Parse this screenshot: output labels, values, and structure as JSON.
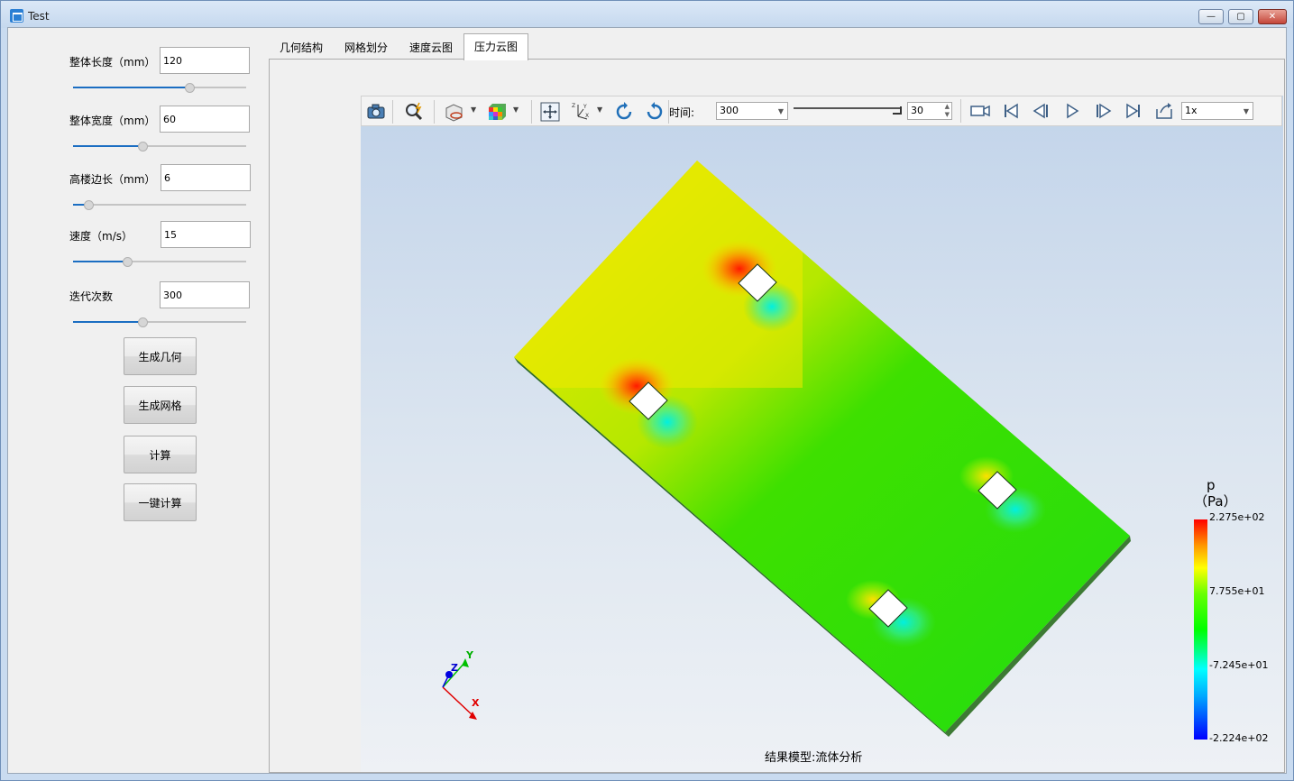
{
  "window": {
    "title": "Test"
  },
  "params": [
    {
      "label": "整体长度（mm）",
      "value": "120",
      "fraction": 0.67
    },
    {
      "label": "整体宽度（mm）",
      "value": "60",
      "fraction": 0.4
    },
    {
      "label": "高楼边长（mm）",
      "value": "6",
      "fraction": 0.09
    },
    {
      "label": "速度（m/s）",
      "value": "15",
      "fraction": 0.31
    },
    {
      "label": "迭代次数",
      "value": "300",
      "fraction": 0.4
    }
  ],
  "buttons": {
    "generate_geometry": "生成几何",
    "generate_mesh": "生成网格",
    "compute": "计算",
    "one_click_compute": "一键计算"
  },
  "tabs": [
    "几何结构",
    "网格划分",
    "速度云图",
    "压力云图"
  ],
  "active_tab": "压力云图",
  "toolbar": {
    "time_label": "时间:",
    "time_value": "300",
    "frame_value": "30",
    "speed_value": "1x",
    "time_fraction": 1.0,
    "icons": [
      "camera-icon",
      "magnifier-icon",
      "surface-display-icon",
      "color-map-icon",
      "fit-view-icon",
      "axes-orientation-icon",
      "rotate-left-icon",
      "rotate-right-icon",
      "video-record-icon",
      "first-frame-icon",
      "previous-frame-icon",
      "play-icon",
      "next-frame-icon",
      "last-frame-icon",
      "export-icon"
    ]
  },
  "viewer": {
    "caption": "结果模型:流体分析",
    "legend_var": "p",
    "legend_unit": "（Pa）",
    "legend_ticks": [
      "2.275e+02",
      "7.755e+01",
      "-7.245e+01",
      "-2.224e+02"
    ],
    "axes": {
      "x": "X",
      "y": "Y",
      "z": "Z"
    }
  }
}
